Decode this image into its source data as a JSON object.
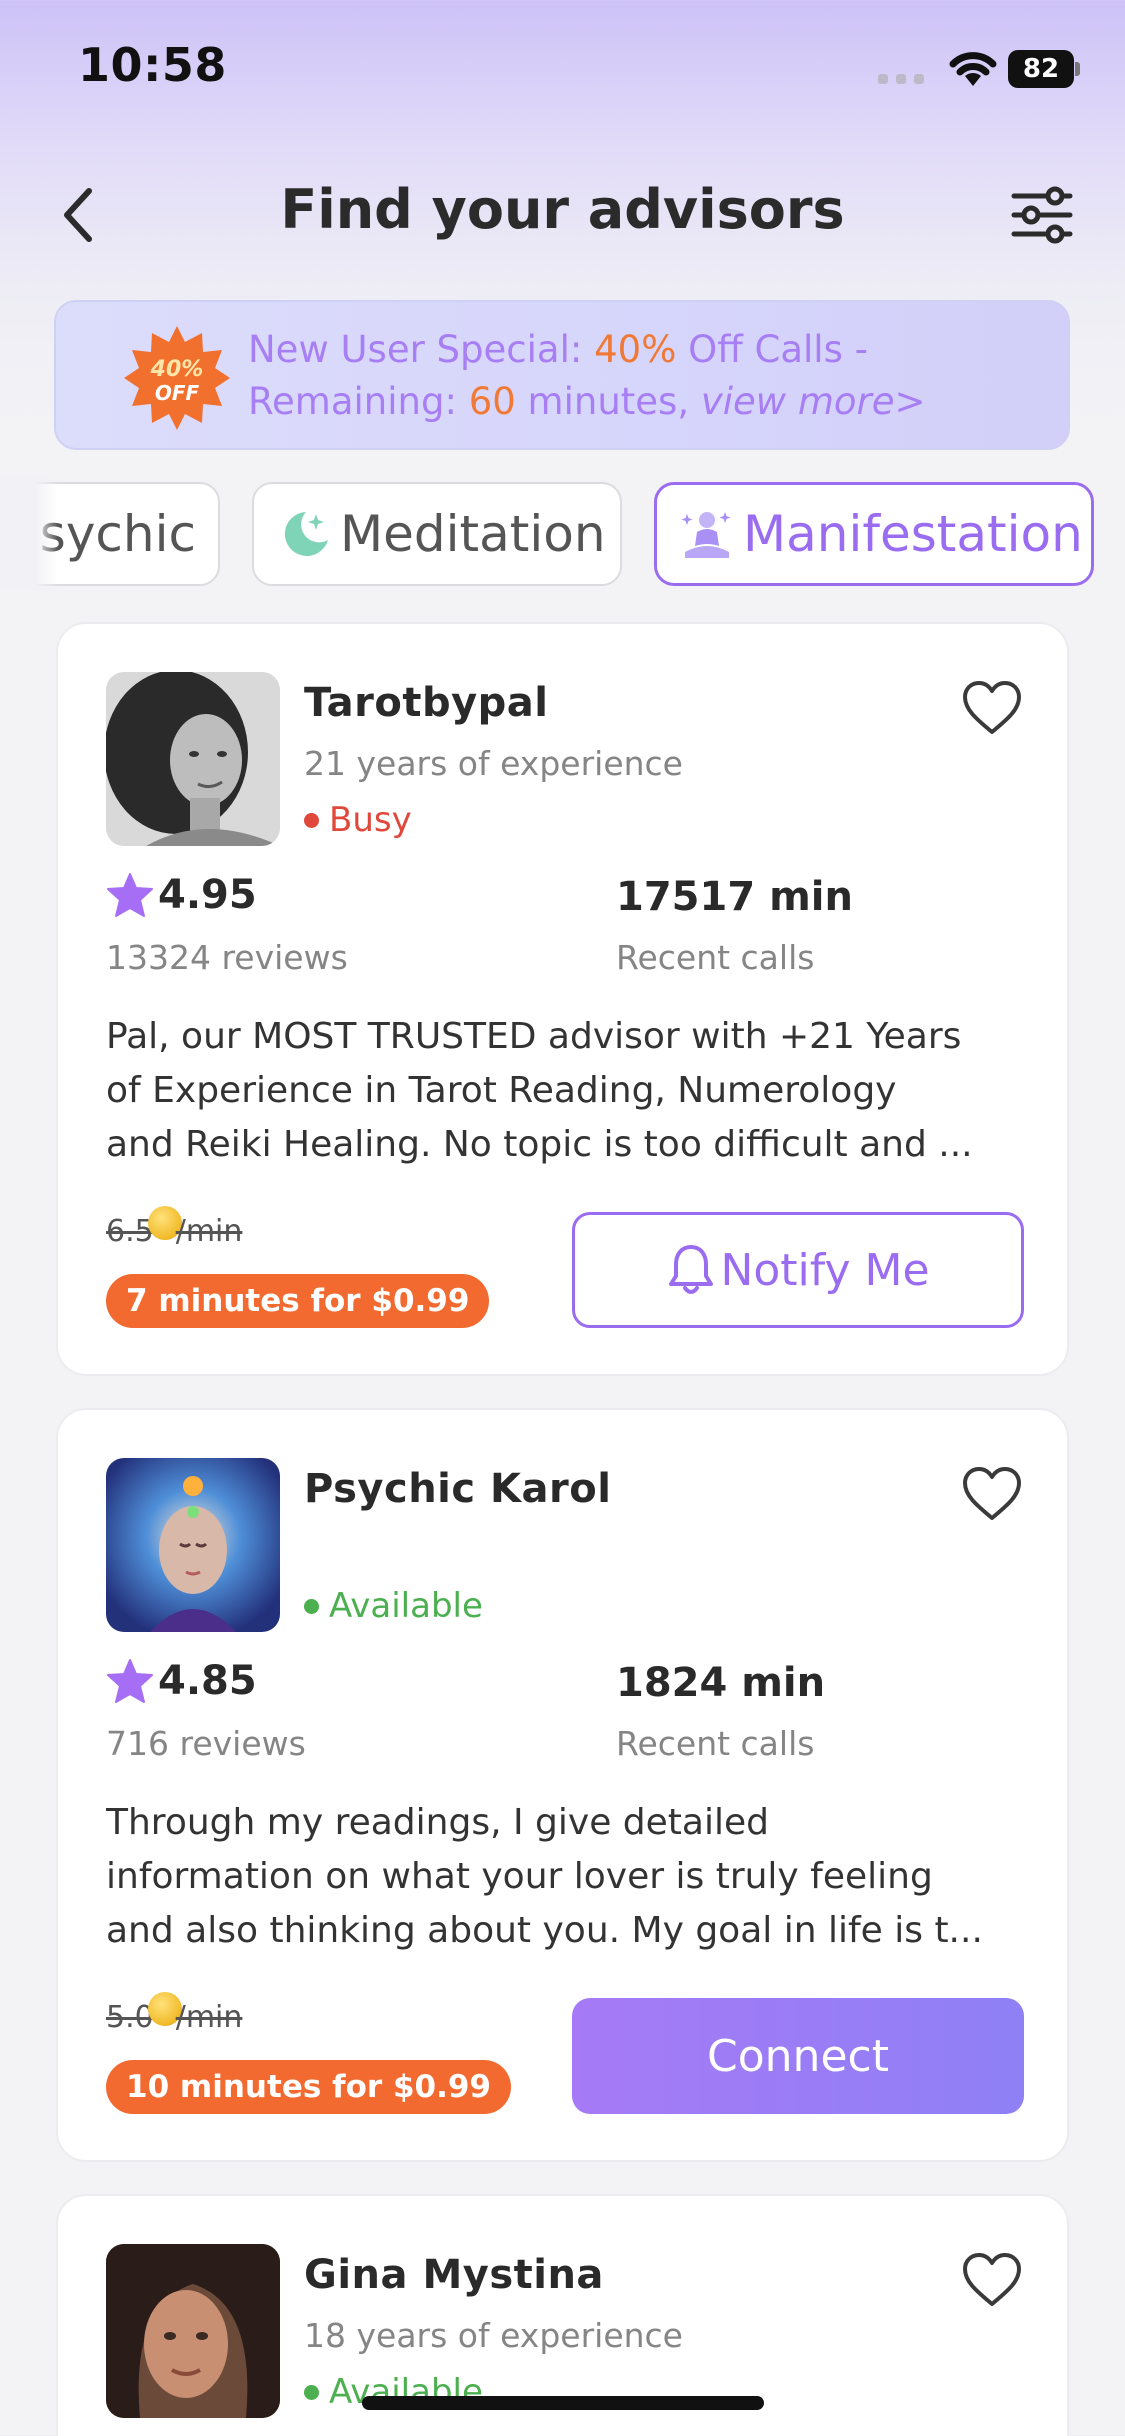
{
  "status_bar": {
    "time": "10:58",
    "battery": "82"
  },
  "header": {
    "title": "Find your advisors",
    "back_icon": "chevron-left-icon",
    "filter_icon": "sliders-icon"
  },
  "promo": {
    "badge_line1": "40%",
    "badge_line2": "OFF",
    "part1": "New User Special: ",
    "discount": "40%",
    "part2": " Off Calls -",
    "part3": "Remaining: ",
    "minutes": "60",
    "part4": " minutes, ",
    "link": "view more>",
    "colors": {
      "text": "#a77ef4",
      "highlight": "#f07a35"
    }
  },
  "categories": [
    {
      "label": "Psychic",
      "visible_label": "sychic",
      "selected": false
    },
    {
      "label": "Meditation",
      "icon": "moon-icon",
      "selected": false
    },
    {
      "label": "Manifestation",
      "icon": "meditating-person-icon",
      "selected": true
    }
  ],
  "advisors": [
    {
      "name": "Tarotbypal",
      "experience": "21 years of experience",
      "status": "Busy",
      "rating": "4.95",
      "reviews": "13324 reviews",
      "minutes": "17517 min",
      "minutes_label": "Recent calls",
      "bio_lines": [
        "Pal, our MOST TRUSTED advisor with +21 Years",
        "of Experience in Tarot Reading, Numerology",
        "and Reiki Healing. No topic is too difficult and ..."
      ],
      "price_value": "6.5",
      "price_unit": "/min",
      "deal": "7 minutes for $0.99",
      "action": "Notify Me"
    },
    {
      "name": "Psychic Karol",
      "experience": "",
      "status": "Available",
      "rating": "4.85",
      "reviews": "716 reviews",
      "minutes": "1824 min",
      "minutes_label": "Recent calls",
      "bio_lines": [
        "Through my readings, I give detailed",
        "information on what your lover is truly feeling",
        "and also thinking about you. My goal in life is t..."
      ],
      "price_value": "5.0",
      "price_unit": "/min",
      "deal": "10 minutes for $0.99",
      "action": "Connect"
    },
    {
      "name": "Gina Mystina",
      "experience": "18 years of experience",
      "status": "Available"
    }
  ],
  "colors": {
    "accent": "#9a6cf0",
    "busy": "#e0483c",
    "available": "#4caf50",
    "deal": "#f26a30"
  }
}
